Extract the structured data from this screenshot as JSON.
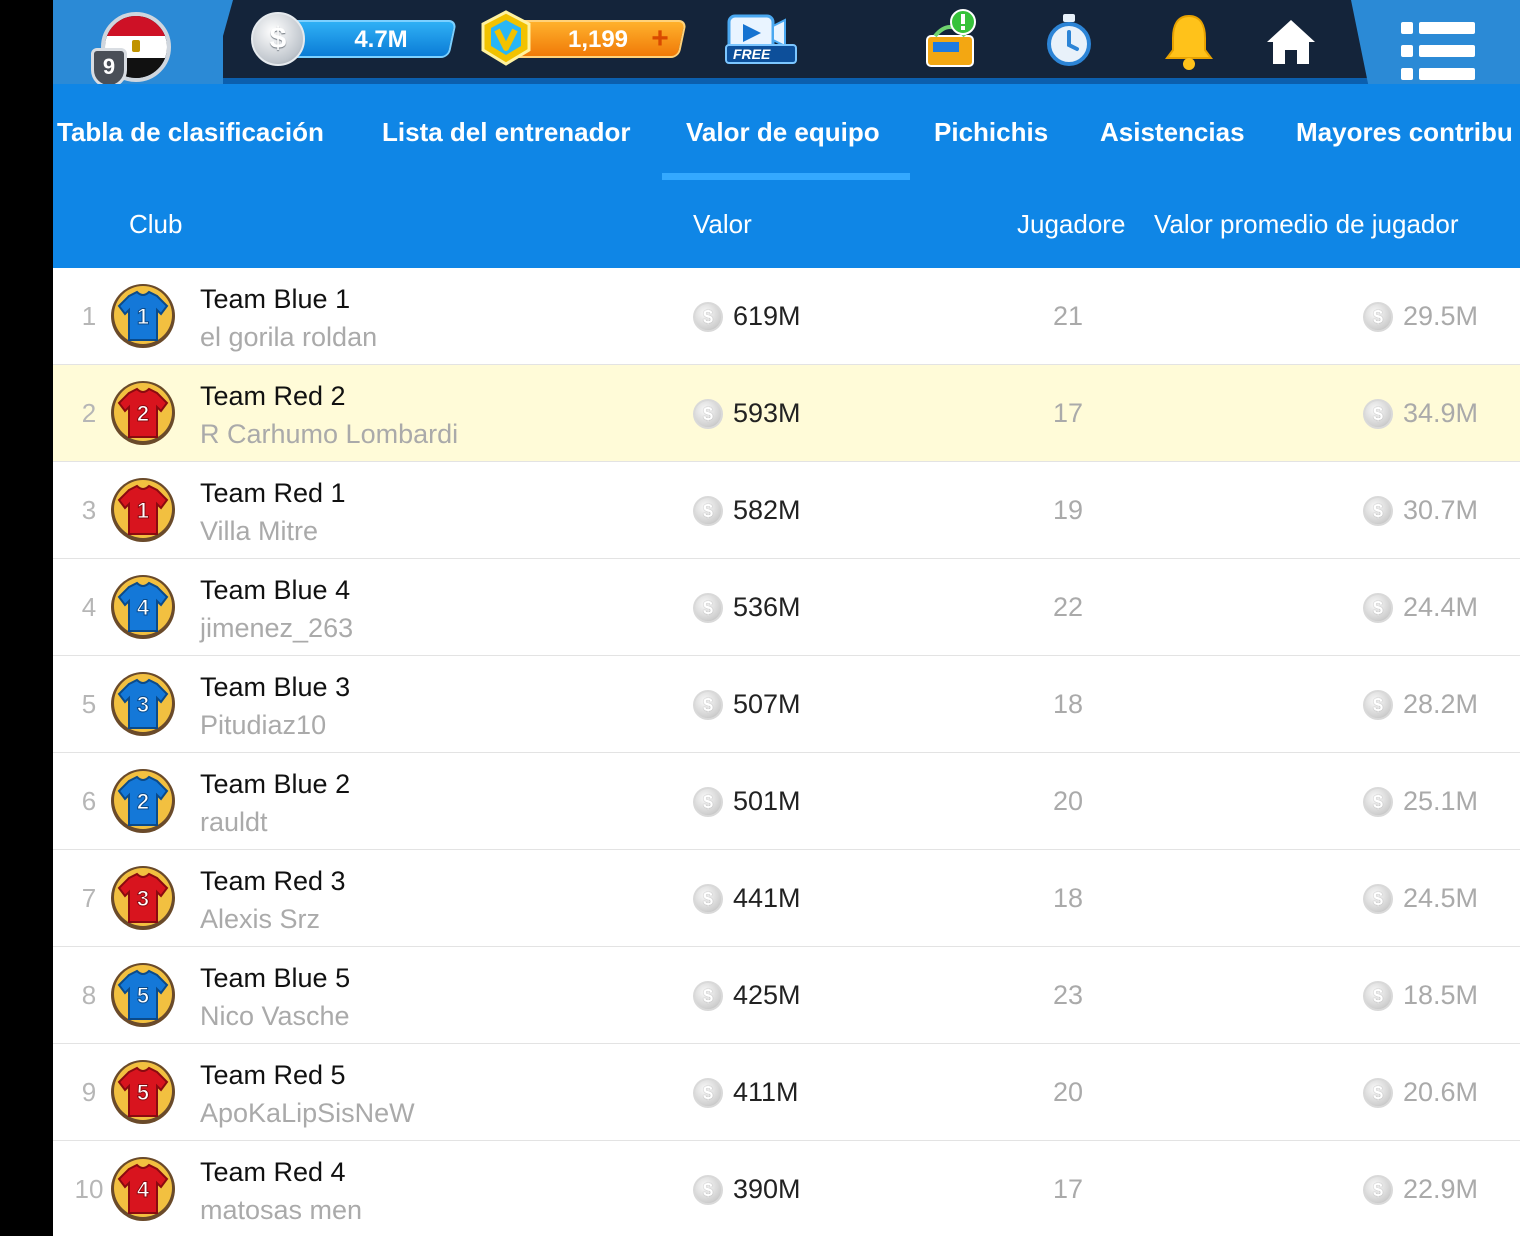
{
  "topbar": {
    "level": "9",
    "cash": "4.7M",
    "cash_icon": "$",
    "boss_coins": "1,199",
    "boss_plus": "+",
    "free_label": "FREE",
    "icons": [
      "free-video-icon",
      "osm-store-icon",
      "stopwatch-icon",
      "bell-icon",
      "home-icon",
      "menu-icon"
    ]
  },
  "tabs": [
    {
      "label": "Tabla de clasificación",
      "active": false
    },
    {
      "label": "Lista del entrenador",
      "active": false
    },
    {
      "label": "Valor de equipo",
      "active": true
    },
    {
      "label": "Pichichis",
      "active": false
    },
    {
      "label": "Asistencias",
      "active": false
    },
    {
      "label": "Mayores contribu",
      "active": false
    }
  ],
  "columns": {
    "club": "Club",
    "value": "Valor",
    "players": "Jugadore",
    "avg": "Valor promedio de jugador"
  },
  "coin_symbol": "$",
  "rows": [
    {
      "rank": "1",
      "team": "Team Blue 1",
      "manager": "el gorila roldan",
      "value": "619M",
      "players": "21",
      "avg": "29.5M",
      "kit": "blue",
      "number": "1"
    },
    {
      "rank": "2",
      "team": "Team Red 2",
      "manager": "R Carhumo Lombardi",
      "value": "593M",
      "players": "17",
      "avg": "34.9M",
      "kit": "red",
      "number": "2",
      "highlight": true
    },
    {
      "rank": "3",
      "team": "Team Red 1",
      "manager": "Villa Mitre",
      "value": "582M",
      "players": "19",
      "avg": "30.7M",
      "kit": "red",
      "number": "1"
    },
    {
      "rank": "4",
      "team": "Team Blue 4",
      "manager": "jimenez_263",
      "value": "536M",
      "players": "22",
      "avg": "24.4M",
      "kit": "blue",
      "number": "4"
    },
    {
      "rank": "5",
      "team": "Team Blue 3",
      "manager": "Pitudiaz10",
      "value": "507M",
      "players": "18",
      "avg": "28.2M",
      "kit": "blue",
      "number": "3"
    },
    {
      "rank": "6",
      "team": "Team Blue 2",
      "manager": "rauldt",
      "value": "501M",
      "players": "20",
      "avg": "25.1M",
      "kit": "blue",
      "number": "2"
    },
    {
      "rank": "7",
      "team": "Team Red 3",
      "manager": "Alexis Srz",
      "value": "441M",
      "players": "18",
      "avg": "24.5M",
      "kit": "red",
      "number": "3"
    },
    {
      "rank": "8",
      "team": "Team Blue 5",
      "manager": "Nico Vasche",
      "value": "425M",
      "players": "23",
      "avg": "18.5M",
      "kit": "blue",
      "number": "5"
    },
    {
      "rank": "9",
      "team": "Team Red 5",
      "manager": "ApoKaLipSisNeW",
      "value": "411M",
      "players": "20",
      "avg": "20.6M",
      "kit": "red",
      "number": "5"
    },
    {
      "rank": "10",
      "team": "Team Red 4",
      "manager": "matosas men",
      "value": "390M",
      "players": "17",
      "avg": "22.9M",
      "kit": "red",
      "number": "4"
    }
  ],
  "colors": {
    "topbar": "#14243a",
    "accent_blue": "#0f86e6",
    "highlight_row": "#fffbd8",
    "kit_blue": "#1478d8",
    "kit_red": "#d8141e"
  }
}
